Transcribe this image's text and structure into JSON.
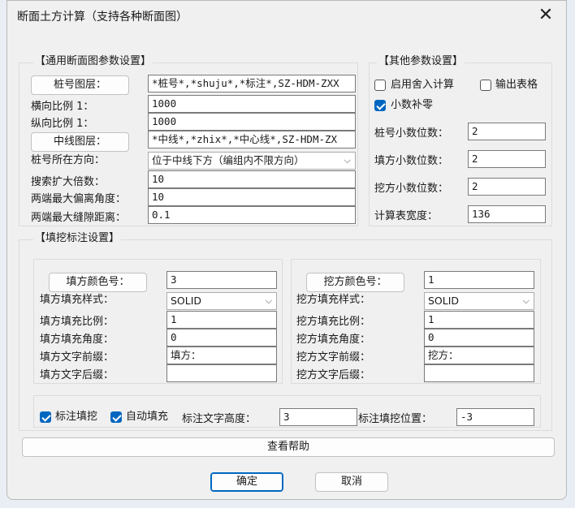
{
  "window": {
    "title": "断面土方计算（支持各种断面图）",
    "close_glyph": "✕"
  },
  "general": {
    "legend": "【通用断面图参数设置】",
    "stake_layer_button": "桩号图层：",
    "stake_layer_value": "*桩号*,*shuju*,*标注*,SZ-HDM-ZXX",
    "h_scale_label": "横向比例 1：",
    "h_scale_value": "1000",
    "v_scale_label": "纵向比例 1：",
    "v_scale_value": "1000",
    "center_layer_button": "中线图层：",
    "center_layer_value": "*中线*,*zhix*,*中心线*,SZ-HDM-ZX",
    "direction_label": "桩号所在方向：",
    "direction_value": "位于中线下方（编组内不限方向）",
    "search_label": "搜索扩大倍数：",
    "search_value": "10",
    "angle_label": "两端最大偏离角度：",
    "angle_value": "10",
    "gap_label": "两端最大缝隙距离：",
    "gap_value": "0.1"
  },
  "other": {
    "legend": "【其他参数设置】",
    "rounding_label": "启用舍入计算",
    "rounding_checked": false,
    "output_table_label": "输出表格",
    "output_table_checked": false,
    "decimal_pad_label": "小数补零",
    "decimal_pad_checked": true,
    "stake_decimals_label": "桩号小数位数：",
    "stake_decimals_value": "2",
    "fill_decimals_label": "填方小数位数：",
    "fill_decimals_value": "2",
    "cut_decimals_label": "挖方小数位数：",
    "cut_decimals_value": "2",
    "table_width_label": "计算表宽度：",
    "table_width_value": "136"
  },
  "annot": {
    "legend": "【填挖标注设置】",
    "fill": {
      "color_button": "填方颜色号：",
      "color_value": "3",
      "pattern_label": "填方填充样式：",
      "pattern_value": "SOLID",
      "ratio_label": "填方填充比例：",
      "ratio_value": "1",
      "angle_label": "填方填充角度：",
      "angle_value": "0",
      "prefix_label": "填方文字前缀：",
      "prefix_value": "填方：",
      "suffix_label": "填方文字后缀：",
      "suffix_value": ""
    },
    "cut": {
      "color_button": "挖方颜色号：",
      "color_value": "1",
      "pattern_label": "挖方填充样式：",
      "pattern_value": "SOLID",
      "ratio_label": "挖方填充比例：",
      "ratio_value": "1",
      "angle_label": "挖方填充角度：",
      "angle_value": "0",
      "prefix_label": "挖方文字前缀：",
      "prefix_value": "挖方：",
      "suffix_label": "挖方文字后缀：",
      "suffix_value": ""
    },
    "label_cutfill_label": "标注填挖",
    "label_cutfill_checked": true,
    "auto_fill_label": "自动填充",
    "auto_fill_checked": true,
    "text_height_label": "标注文字高度：",
    "text_height_value": "3",
    "position_label": "标注填挖位置：",
    "position_value": "-3"
  },
  "buttons": {
    "help": "查看帮助",
    "ok": "确定",
    "cancel": "取消"
  },
  "colors": {
    "accent": "#0067c0",
    "dialog_bg": "#f0f0f0"
  }
}
